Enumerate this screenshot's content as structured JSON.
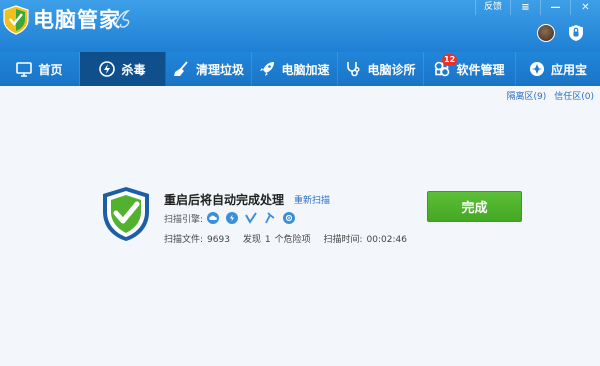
{
  "app": {
    "title": "电脑管家",
    "window_controls": [
      "反馈",
      "≡",
      "—",
      "✕"
    ]
  },
  "nav": {
    "items": [
      {
        "label": "首页",
        "icon": "monitor-icon"
      },
      {
        "label": "杀毒",
        "icon": "virus-scan-icon",
        "active": true
      },
      {
        "label": "清理垃圾",
        "icon": "broom-icon"
      },
      {
        "label": "电脑加速",
        "icon": "rocket-icon"
      },
      {
        "label": "电脑诊所",
        "icon": "stethoscope-icon"
      },
      {
        "label": "软件管理",
        "icon": "software-icon",
        "badge": "12"
      },
      {
        "label": "应用宝",
        "icon": "app-store-icon"
      }
    ]
  },
  "links": {
    "quarantine": "隔离区(9)",
    "trust": "信任区(0)"
  },
  "result": {
    "title": "重启后将自动完成处理",
    "rescan": "重新扫描",
    "engine_label": "扫描引擎:",
    "engines": [
      "cloud-engine-icon",
      "antivirus-engine-icon",
      "system-repair-engine-icon",
      "qq-engine-icon",
      "heuristic-engine-icon"
    ],
    "files_label": "扫描文件:",
    "files_value": "9693",
    "found_label": "发现",
    "found_value": "1",
    "found_unit": "个危险项",
    "time_label": "扫描时间:",
    "time_value": "00:02:46"
  },
  "done_button": "完成",
  "colors": {
    "titlebar": "#2a8ae0",
    "nav_active": "#0e4f8c",
    "accent_green": "#4cb02a",
    "link_blue": "#2b6ec4"
  }
}
